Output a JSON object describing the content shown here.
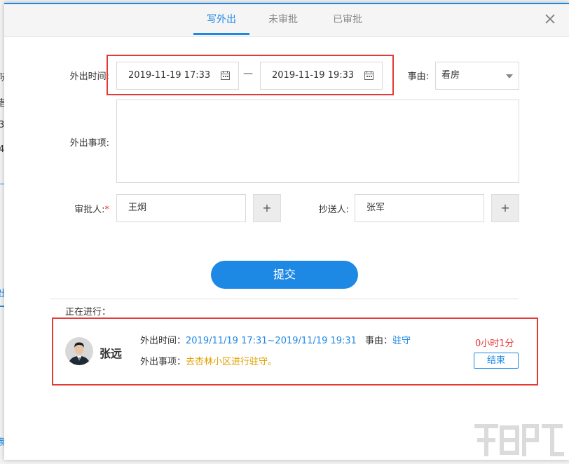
{
  "background": {
    "left_snippets": [
      "阮",
      "昔",
      "3",
      "4",
      "出",
      "新"
    ]
  },
  "tabs": [
    {
      "label": "写外出",
      "active": true
    },
    {
      "label": "未审批",
      "active": false
    },
    {
      "label": "已审批",
      "active": false
    }
  ],
  "form": {
    "time_label": "外出时间:",
    "start_time": "2019-11-19 17:33",
    "end_time": "2019-11-19 19:33",
    "range_separator": "—",
    "reason_label": "事由:",
    "reason_value": "看房",
    "matter_label": "外出事项:",
    "matter_value": "",
    "approver_label": "审批人:",
    "approver_required_mark": "*",
    "approver_value": "王炯",
    "cc_label": "抄送人:",
    "cc_value": "张军",
    "add_symbol": "+",
    "submit_label": "提交"
  },
  "ongoing": {
    "section_title": "正在进行：",
    "name": "张远",
    "time_label": "外出时间：",
    "time_value": "2019/11/19 17:31~2019/11/19 19:31",
    "reason_label": "事由：",
    "reason_value": "驻守",
    "matter_label": "外出事项：",
    "matter_value": "去杏林小区进行驻守。",
    "duration": "0小时1分",
    "end_label": "结束"
  },
  "colors": {
    "accent": "#1e88e5",
    "highlight_border": "#e53935",
    "matter_text": "#e0a100"
  },
  "icons": [
    "close-icon",
    "calendar-icon",
    "dropdown-arrow-icon",
    "avatar-photo"
  ]
}
